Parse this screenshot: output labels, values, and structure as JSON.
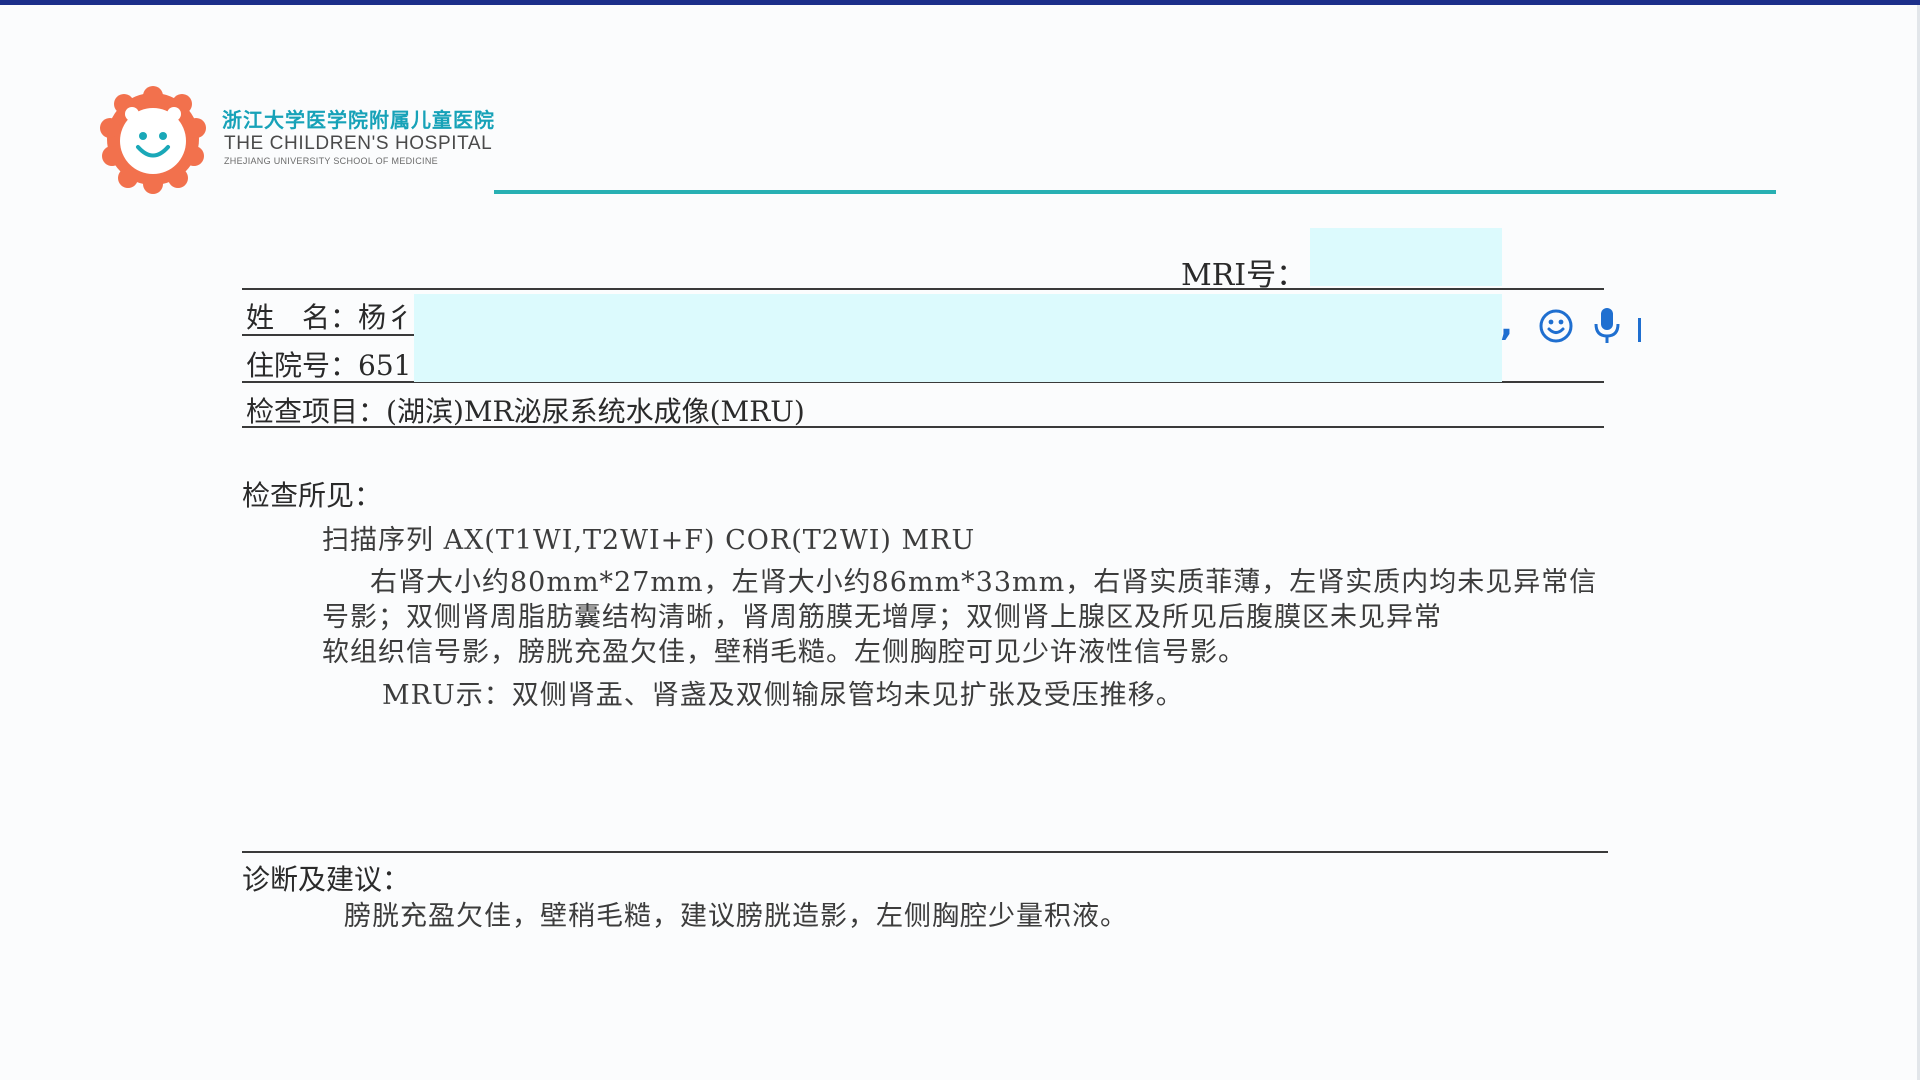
{
  "colors": {
    "top_bar": "#1c2f8a",
    "teal_rule": "#28b0b3",
    "redaction": "#dcfafd",
    "logo_orange": "#f2714d",
    "icon_blue": "#1f6fd0"
  },
  "header": {
    "hospital_cn": "浙江大学医学院附属儿童医院",
    "hospital_en": "THE CHILDREN'S HOSPITAL",
    "hospital_en_sub": "ZHEJIANG UNIVERSITY SCHOOL OF MEDICINE"
  },
  "patient": {
    "mri_label": "MRI号：",
    "name_label": "姓　名：",
    "name_value": "杨彳",
    "admission_label": "住院号：",
    "admission_value": "651",
    "exam_label": "检查项目：",
    "exam_value": "(湖滨)MR泌尿系统水成像(MRU)"
  },
  "findings": {
    "title": "检查所见：",
    "sequence": "扫描序列 AX(T1WI,T2WI+F) COR(T2WI) MRU",
    "para1_line1": "右肾大小约80mm*27mm，左肾大小约86mm*33mm，右肾实质菲薄，左肾实质内均未见异常信",
    "para1_line2": "号影；双侧肾周脂肪囊结构清晰，肾周筋膜无增厚；双侧肾上腺区及所见后腹膜区未见异常",
    "para1_line3": "软组织信号影，膀胱充盈欠佳，壁稍毛糙。左侧胸腔可见少许液性信号影。",
    "mru": "MRU示：双侧肾盂、肾盏及双侧输尿管均未见扩张及受压推移。"
  },
  "diagnosis": {
    "title": "诊断及建议：",
    "text": "膀胱充盈欠佳，壁稍毛糙，建议膀胱造影，左侧胸腔少量积液。"
  },
  "overlay_icons": [
    "comma-icon",
    "smiley-icon",
    "microphone-icon",
    "text-cursor-icon"
  ]
}
